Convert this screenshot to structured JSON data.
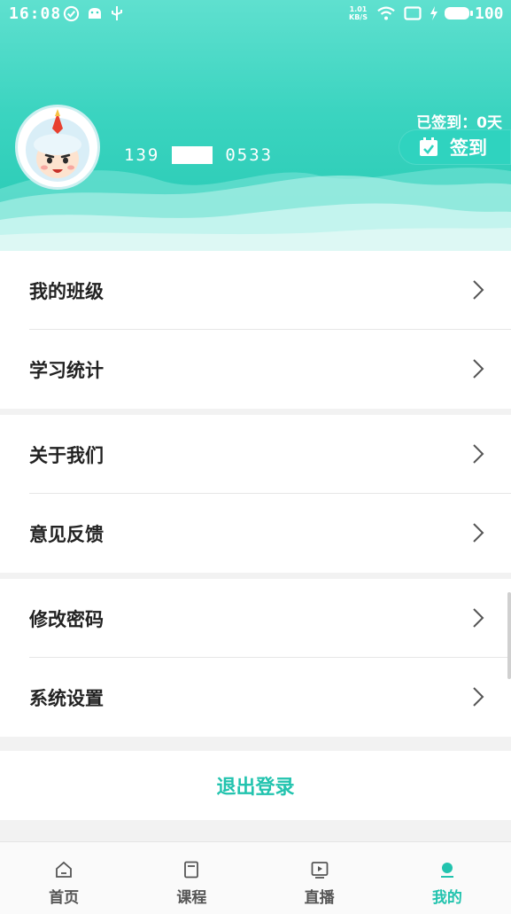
{
  "status_bar": {
    "time": "16:08",
    "net_speed_value": "1.01",
    "net_speed_unit": "KB/S",
    "battery": "100",
    "icons": [
      "check-circle-icon",
      "android-icon",
      "usb-icon",
      "wifi-icon",
      "screen-icon",
      "charging-icon",
      "battery-icon"
    ]
  },
  "profile": {
    "avatar": "cartoon-avatar",
    "phone_prefix": "139",
    "phone_suffix": "0533",
    "checkin_days_text": "已签到：0天",
    "checkin_button_label": "签到",
    "checkin_icon": "calendar-check-icon"
  },
  "menu": {
    "group1": [
      {
        "label": "我的班级"
      },
      {
        "label": "学习统计"
      }
    ],
    "group2": [
      {
        "label": "关于我们"
      },
      {
        "label": "意见反馈"
      }
    ],
    "group3": [
      {
        "label": "修改密码"
      },
      {
        "label": "系统设置"
      }
    ]
  },
  "logout_label": "退出登录",
  "bottom_nav": [
    {
      "label": "首页",
      "icon": "home-icon"
    },
    {
      "label": "课程",
      "icon": "book-icon"
    },
    {
      "label": "直播",
      "icon": "live-play-icon"
    },
    {
      "label": "我的",
      "icon": "profile-dot-icon",
      "active": true
    }
  ],
  "colors": {
    "accent": "#22c3ae",
    "header_top": "#5fe0cf",
    "header_bottom": "#26c9b3"
  }
}
